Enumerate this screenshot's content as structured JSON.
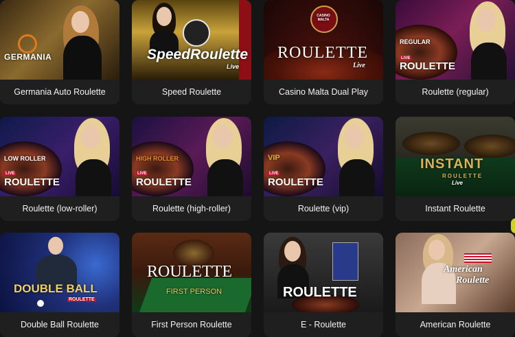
{
  "games": [
    {
      "title": "Germania Auto Roulette",
      "logo": "GERMANIA"
    },
    {
      "title": "Speed Roulette",
      "logo": "SpeedRoulette",
      "logo_sub": "Live"
    },
    {
      "title": "Casino Malta Dual Play",
      "logo": "ROULETTE",
      "logo_sub": "Live",
      "emblem": "CASINO MALTA"
    },
    {
      "title": "Roulette (regular)",
      "logo_top": "REGULAR",
      "logo": "ROULETTE",
      "logo_live": "LIVE"
    },
    {
      "title": "Roulette (low-roller)",
      "logo_top": "LOW ROLLER",
      "logo": "ROULETTE",
      "logo_live": "LIVE"
    },
    {
      "title": "Roulette (high-roller)",
      "logo_top": "HIGH ROLLER",
      "logo": "ROULETTE",
      "logo_live": "LIVE"
    },
    {
      "title": "Roulette (vip)",
      "logo_top": "VIP",
      "logo": "ROULETTE",
      "logo_live": "LIVE"
    },
    {
      "title": "Instant Roulette",
      "logo": "INSTANT",
      "logo_mid": "ROULETTE",
      "logo_sub": "Live"
    },
    {
      "title": "Double Ball Roulette",
      "logo": "DOUBLE BALL",
      "logo_sub": "ROULETTE"
    },
    {
      "title": "First Person Roulette",
      "logo": "ROULETTE",
      "logo_sub": "FIRST PERSON"
    },
    {
      "title": "E - Roulette",
      "logo": "ROULETTE"
    },
    {
      "title": "American Roulette",
      "logo": "American",
      "logo_sub": "Roulette"
    }
  ],
  "colors": {
    "page_bg": "#151515",
    "card_bg": "#1f1f1f",
    "caption_text": "#f2f2f2",
    "accent_gold": "#d9b25a",
    "accent_red": "#c8102e"
  }
}
